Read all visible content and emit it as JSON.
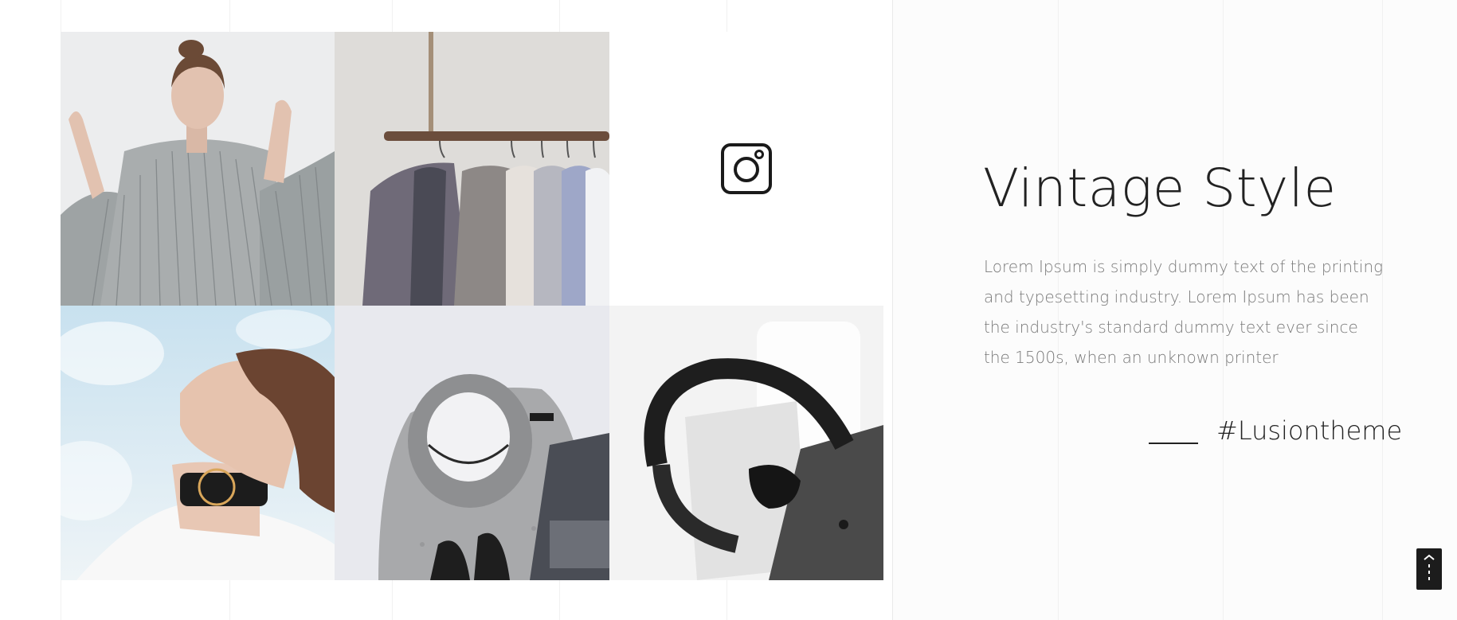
{
  "gallery": {
    "tiles": [
      {
        "label": "woman in pleated sheer dress"
      },
      {
        "label": "jackets and shirts on hanging rail"
      },
      {
        "label": "instagram"
      },
      {
        "label": "woman with choker and gold earring"
      },
      {
        "label": "grey hat, knit sweater, boots and magazine flat lay"
      },
      {
        "label": "black leather bag and sunglasses"
      }
    ],
    "instagram_icon": "instagram-icon"
  },
  "content": {
    "title": "Vintage Style",
    "description": "Lorem Ipsum is simply dummy text of the printing and typesetting industry. Lorem Ipsum has been the industry's standard dummy text ever since the 1500s, when an unknown printer",
    "hashtag": "#Lusiontheme"
  },
  "scroll_top": {
    "icon": "chevron-up-icon"
  },
  "colors": {
    "text": "#222222",
    "muted": "#7a7a7a",
    "button": "#1c1c1c"
  }
}
